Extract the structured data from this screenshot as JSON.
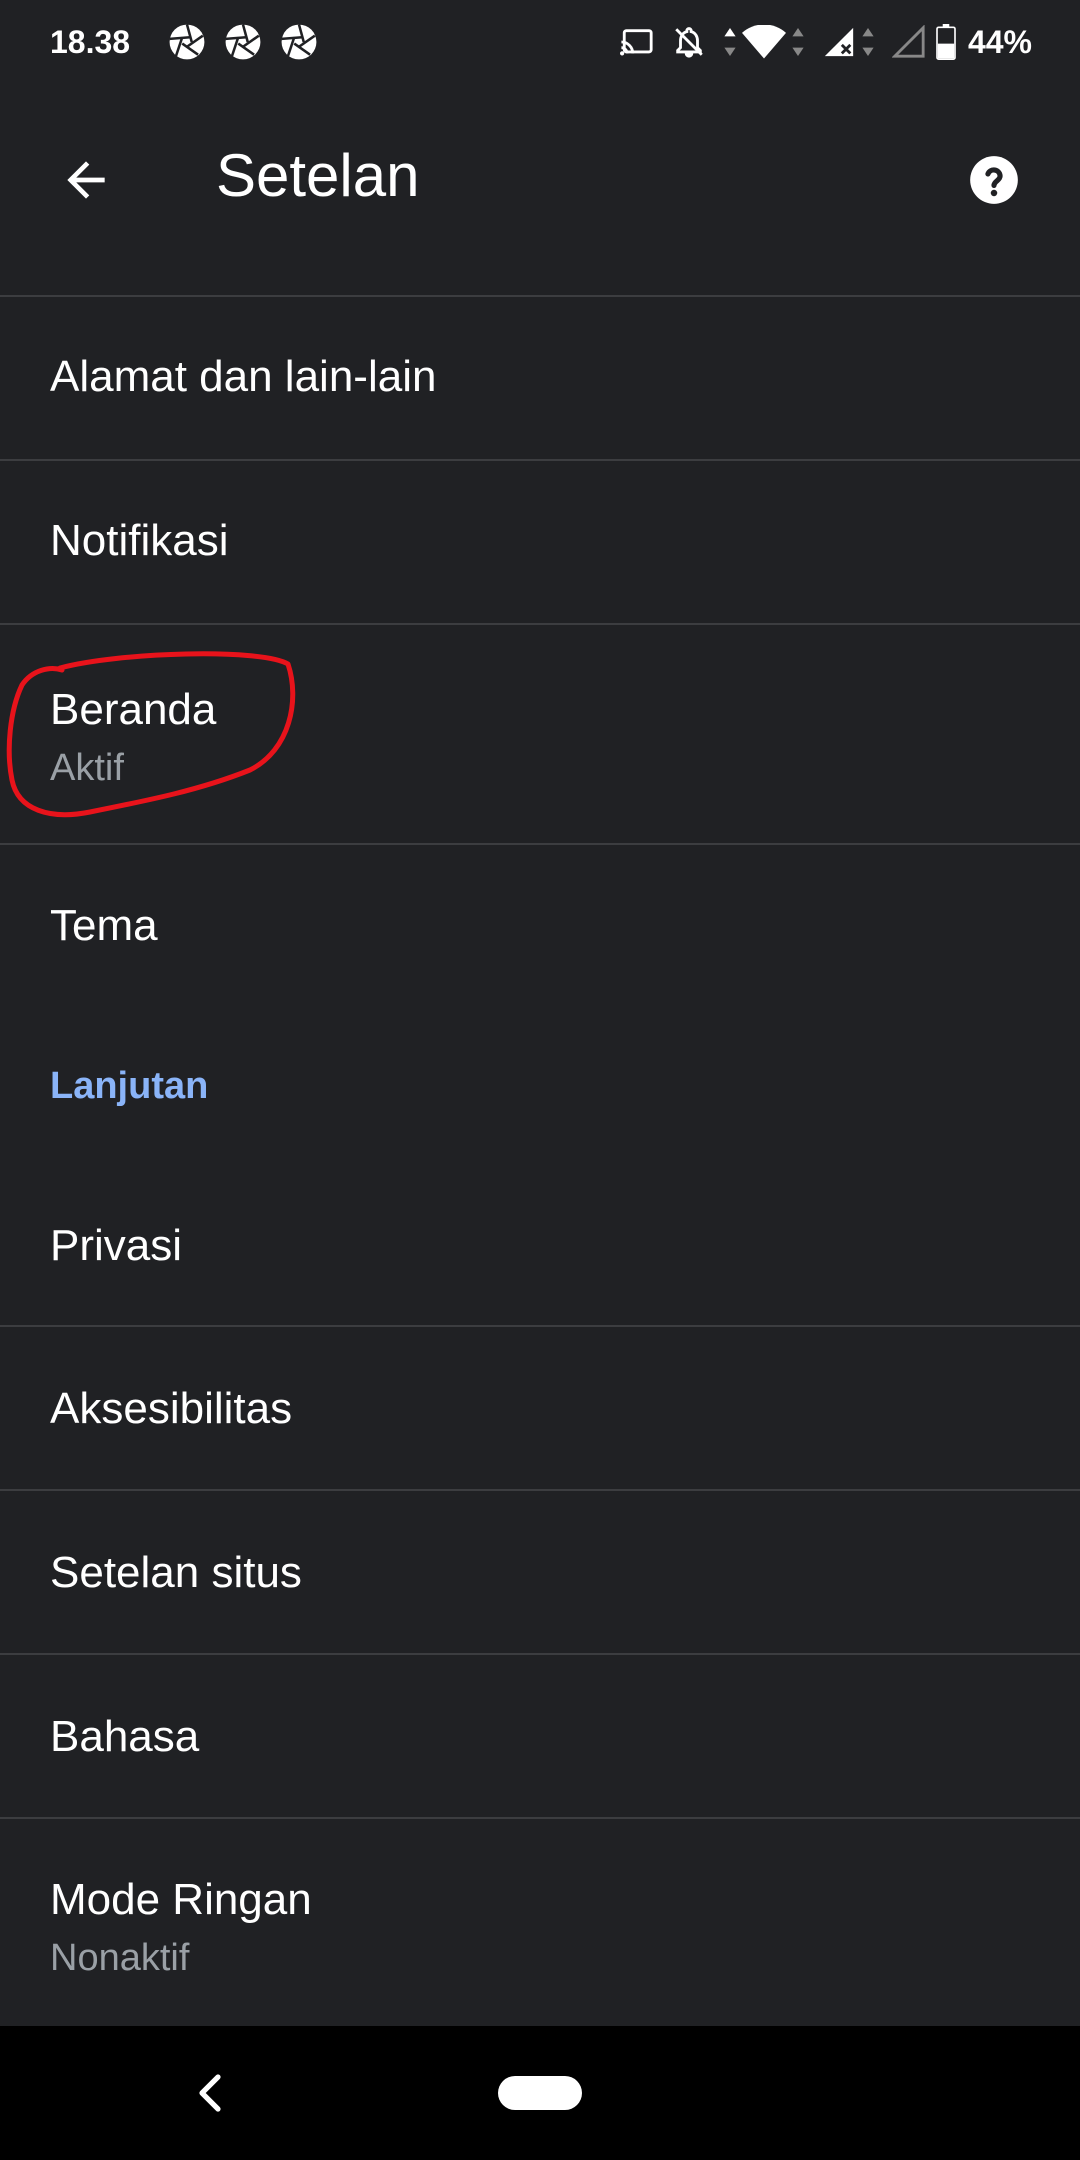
{
  "status_bar": {
    "time": "18.38",
    "battery_percent": "44%"
  },
  "app_bar": {
    "title": "Setelan"
  },
  "settings": {
    "items": [
      {
        "title": "Alamat dan lain-lain"
      },
      {
        "title": "Notifikasi"
      },
      {
        "title": "Beranda",
        "subtitle": "Aktif"
      },
      {
        "title": "Tema"
      },
      {
        "title": "Privasi"
      },
      {
        "title": "Aksesibilitas"
      },
      {
        "title": "Setelan situs"
      },
      {
        "title": "Bahasa"
      },
      {
        "title": "Mode Ringan",
        "subtitle": "Nonaktif"
      }
    ],
    "section_header": "Lanjutan"
  },
  "colors": {
    "background": "#202124",
    "accent": "#8ab4f8",
    "annotation": "#e8131b"
  }
}
